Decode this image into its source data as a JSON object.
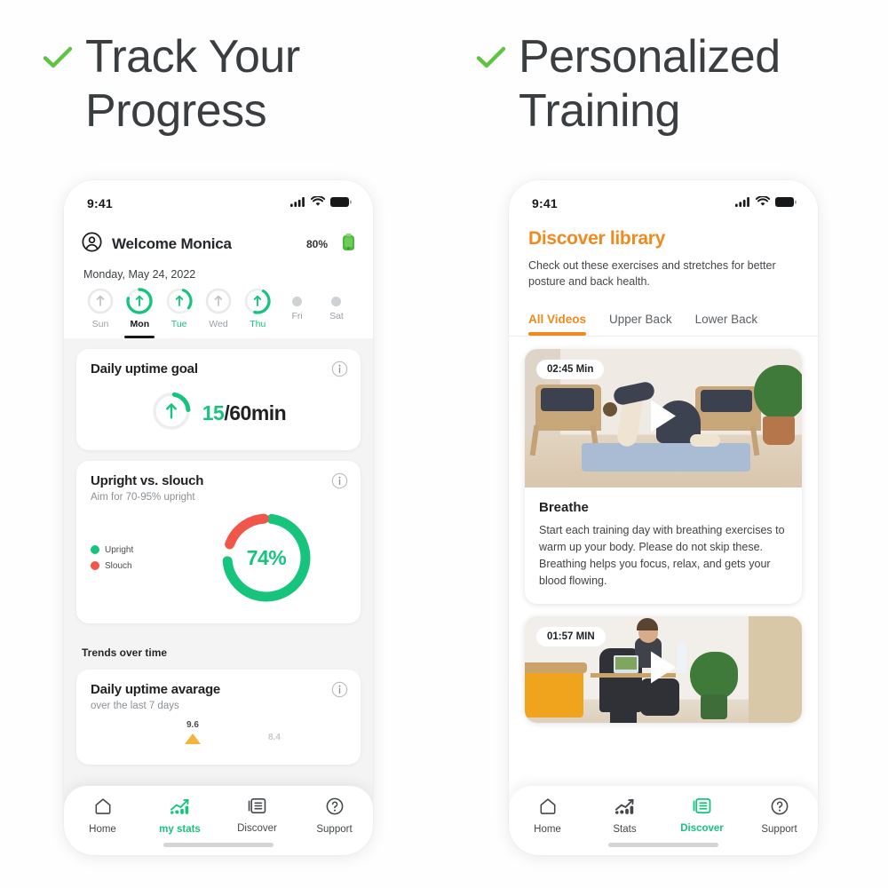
{
  "headlines": {
    "left": "Track Your Progress",
    "right": "Personalized Training",
    "check_icon": "check-icon"
  },
  "colors": {
    "green": "#17c47d",
    "red": "#f0574a",
    "orange": "#f08a1e",
    "text_dark": "#1f2123",
    "text_muted": "#8b9096",
    "page_bg": "#fefefe"
  },
  "left_phone": {
    "status": {
      "time": "9:41",
      "signal_icon": "signal-bars-icon",
      "wifi_icon": "wifi-icon",
      "battery_icon": "battery-icon"
    },
    "header": {
      "avatar_icon": "user-avatar-icon",
      "welcome": "Welcome Monica",
      "battery_percent": "80%",
      "device_battery_icon": "device-battery-icon",
      "date": "Monday, May 24, 2022"
    },
    "days": [
      {
        "label": "Sun",
        "progress": 0,
        "style": "ring",
        "state": "inactive"
      },
      {
        "label": "Mon",
        "progress": 78,
        "style": "ring",
        "state": "active"
      },
      {
        "label": "Tue",
        "progress": 30,
        "style": "ring",
        "state": "green"
      },
      {
        "label": "Wed",
        "progress": 0,
        "style": "ring",
        "state": "inactive"
      },
      {
        "label": "Thu",
        "progress": 45,
        "style": "ring",
        "state": "green"
      },
      {
        "label": "Fri",
        "progress": 0,
        "style": "dot",
        "state": "empty"
      },
      {
        "label": "Sat",
        "progress": 0,
        "style": "dot",
        "state": "empty"
      }
    ],
    "goal_card": {
      "title": "Daily uptime goal",
      "info_icon": "info-icon",
      "arrow_icon": "up-arrow-icon",
      "value": "15",
      "suffix": "/60min",
      "ring_progress": 25
    },
    "posture_card": {
      "title": "Upright vs. slouch",
      "subtitle": "Aim for 70-95% upright",
      "info_icon": "info-icon",
      "center_value": "74%",
      "legend": [
        {
          "label": "Upright",
          "color": "#17c47d"
        },
        {
          "label": "Slouch",
          "color": "#f0574a"
        }
      ]
    },
    "trends_label": "Trends over time",
    "trends_card": {
      "title": "Daily uptime avarage",
      "subtitle": "over the last 7 days",
      "info_icon": "info-icon",
      "points": [
        "9.6",
        "8.4"
      ]
    },
    "nav": [
      {
        "label": "Home",
        "icon": "home-icon",
        "active": false
      },
      {
        "label": "my stats",
        "icon": "stats-icon",
        "active": true
      },
      {
        "label": "Discover",
        "icon": "discover-icon",
        "active": false
      },
      {
        "label": "Support",
        "icon": "support-icon",
        "active": false
      }
    ]
  },
  "right_phone": {
    "status": {
      "time": "9:41",
      "signal_icon": "signal-bars-icon",
      "wifi_icon": "wifi-icon",
      "battery_icon": "battery-icon"
    },
    "header": {
      "title": "Discover library",
      "subtitle": "Check out these exercises and stretches for better posture and back health."
    },
    "tabs": [
      {
        "label": "All Videos",
        "active": true
      },
      {
        "label": "Upper Back",
        "active": false
      },
      {
        "label": "Lower Back",
        "active": false
      }
    ],
    "videos": [
      {
        "duration": "02:45 Min",
        "play_icon": "play-icon",
        "title": "Breathe",
        "description": "Start each training day with breathing exercises to warm up your body. Please do not skip these. Breathing helps you focus, relax, and gets your blood flowing."
      },
      {
        "duration": "01:57 MIN",
        "play_icon": "play-icon",
        "title": "",
        "description": ""
      }
    ],
    "nav": [
      {
        "label": "Home",
        "icon": "home-icon",
        "active": false
      },
      {
        "label": "Stats",
        "icon": "stats-icon",
        "active": false
      },
      {
        "label": "Discover",
        "icon": "discover-icon",
        "active": true
      },
      {
        "label": "Support",
        "icon": "support-icon",
        "active": false
      }
    ]
  }
}
